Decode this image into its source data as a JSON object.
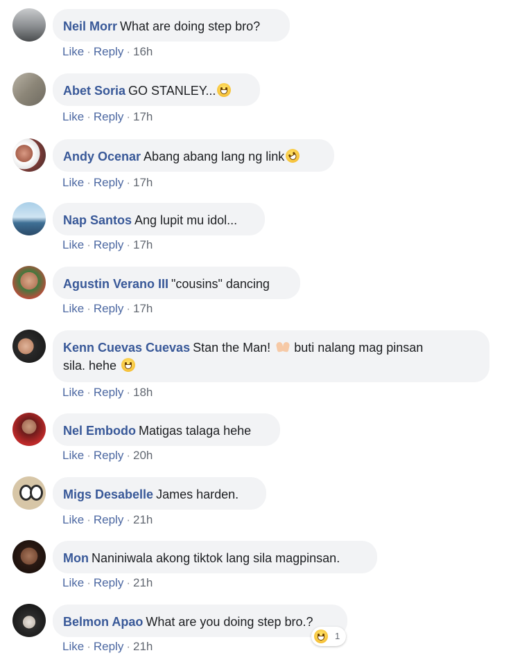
{
  "labels": {
    "like": "Like",
    "reply": "Reply",
    "sep": "·"
  },
  "comments": [
    {
      "author": "Neil Morr",
      "text": "What are doing step bro?",
      "time": "16h",
      "emoji": ""
    },
    {
      "author": "Abet Soria",
      "text": "GO STANLEY...",
      "time": "17h",
      "emoji": "grinning-face"
    },
    {
      "author": "Andy Ocenar",
      "text": "Abang abang lang ng link",
      "time": "17h",
      "emoji": "rolling-laughing-face"
    },
    {
      "author": "Nap Santos",
      "text": "Ang lupit mu idol...",
      "time": "17h",
      "emoji": ""
    },
    {
      "author": "Agustin Verano III",
      "text": "\"cousins\" dancing",
      "time": "17h",
      "emoji": ""
    },
    {
      "author": "Kenn Cuevas Cuevas",
      "text": "Stan the Man!",
      "text2": "buti nalang mag pinsan",
      "text3": "sila. hehe",
      "time": "18h",
      "emoji": "raising-hands"
    },
    {
      "author": "Nel Embodo",
      "text": "Matigas talaga hehe",
      "time": "20h",
      "emoji": ""
    },
    {
      "author": "Migs Desabelle",
      "text": "James harden.",
      "time": "21h",
      "emoji": ""
    },
    {
      "author": "Mon",
      "text": "Naniniwala akong tiktok lang sila magpinsan.",
      "time": "21h",
      "emoji": ""
    },
    {
      "author": "Belmon Apao",
      "text": "What are you doing step bro.?",
      "time": "21h",
      "emoji": ""
    }
  ],
  "reaction": {
    "icon": "laughing-face",
    "count": "1"
  },
  "colors": {
    "author": "#385898",
    "action": "#4b67a1",
    "bubble": "#f2f3f5"
  }
}
